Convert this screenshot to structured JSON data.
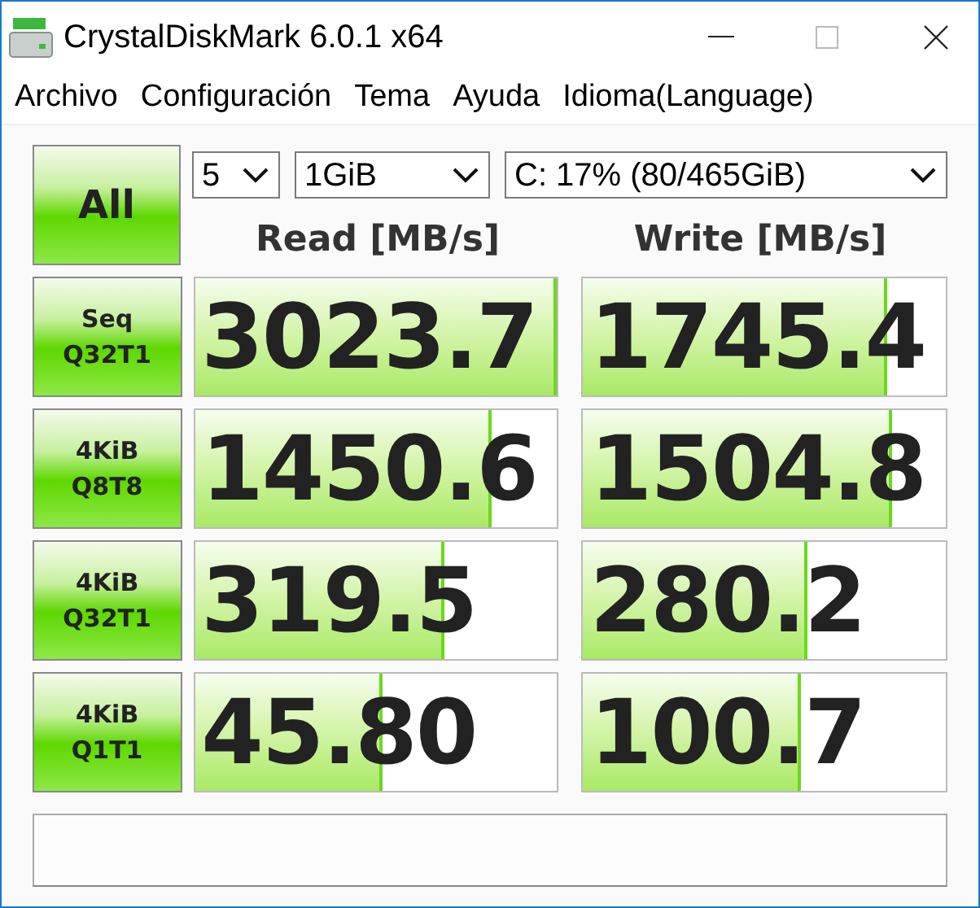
{
  "window": {
    "title": "CrystalDiskMark 6.0.1 x64"
  },
  "menu": [
    "Archivo",
    "Configuración",
    "Tema",
    "Ayuda",
    "Idioma(Language)"
  ],
  "all_button": "All",
  "selects": [
    "5",
    "1GiB",
    "C: 17% (80/465GiB)"
  ],
  "columns": [
    "Read [MB/s]",
    "Write [MB/s]"
  ],
  "tests": [
    {
      "label": [
        "Seq",
        "Q32T1"
      ],
      "read": {
        "value": "3023.7",
        "level": 1.0
      },
      "write": {
        "value": "1745.4",
        "level": 0.84
      }
    },
    {
      "label": [
        "4KiB",
        "Q8T8"
      ],
      "read": {
        "value": "1450.6",
        "level": 0.82
      },
      "write": {
        "value": "1504.8",
        "level": 0.85
      }
    },
    {
      "label": [
        "4KiB",
        "Q32T1"
      ],
      "read": {
        "value": "319.5",
        "level": 0.69
      },
      "write": {
        "value": "280.2",
        "level": 0.62
      }
    },
    {
      "label": [
        "4KiB",
        "Q1T1"
      ],
      "read": {
        "value": "45.80",
        "level": 0.52
      },
      "write": {
        "value": "100.7",
        "level": 0.6
      }
    }
  ]
}
